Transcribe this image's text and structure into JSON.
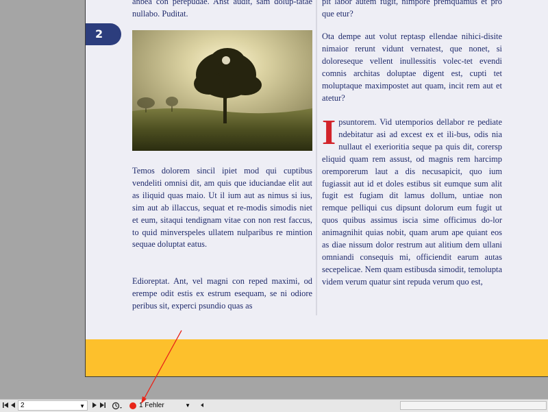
{
  "page_tab": {
    "number": "2"
  },
  "text": {
    "left_top": "anbea con perepudae. Anst audit, sam dolup-tatae nullabo. Puditat.",
    "left_p1": "Temos dolorem sincil ipiet mod qui cuptibus vendeliti omnisi dit, am quis que iduciandae elit aut as iliquid quas maio. Ut il ium aut as nimus si ius, sim aut ab illaccus, sequat et re-modis simodis niet et eum, sitaqui tendignam vitae con non rest faccus, to quid minverspeles ullatem nulparibus re mintion sequae doluptat eatus.",
    "left_p2": "Edioreptat. Ant, vel magni con reped maximi, od erempe odit estis ex estrum esequam, se ni odiore peribus sit, experci psundio quas as",
    "right_top": "pit labor autem fugit, nimpore premquamus et pro que etur?",
    "right_p1": "Ota dempe aut volut reptasp ellendae nihici-disite nimaior rerunt vidunt vernatest, que nonet, si doloreseque vellent inullessitis volec-tet evendi comnis architas doluptae digent est, cupti tet moluptaque maximpostet aut quam, incit rem aut et atetur?",
    "right_p2_dropcap": "I",
    "right_p2": "psuntorem. Vid utemporios dellabor re pediate ndebitatur asi ad excest ex et ili-bus, odis nia nullaut el exerioritia seque pa quis dit, corersp eliquid quam rem assust, od magnis rem harcimp oremporerum laut a dis necusapicit, quo ium fugiassit aut id et doles estibus sit eumque sum alit fugit est fugiam dit lamus dollum, untiae non remque pelliqui cus dipsunt dolorum eum fugit ut quos quibus assimus iscia sime officimus do-lor animagnihit quias nobit, quam arum ape quiant eos as diae nissum dolor restrum aut alitium dem ullani omniandi consequis mi, officiendit earum autas secepelicae. Nem quam estibusda simodit, temolupta videm verum quatur sint repuda verum quo est,"
  },
  "statusbar": {
    "page_value": "2",
    "error_label": "1 Fehler"
  },
  "icons": {
    "first": "first-page-icon",
    "prev": "prev-page-icon",
    "next": "next-page-icon",
    "last": "last-page-icon",
    "preflight": "preflight-icon",
    "error": "error-dot-icon"
  },
  "colors": {
    "pasteboard": "#a5a5a5",
    "page": "#eeeef5",
    "text": "#1f2a6b",
    "tab": "#2c3d7d",
    "dropcap": "#d2232a",
    "band": "#fdc02c",
    "error": "#e8261a",
    "annotation_arrow": "#e8261a"
  }
}
